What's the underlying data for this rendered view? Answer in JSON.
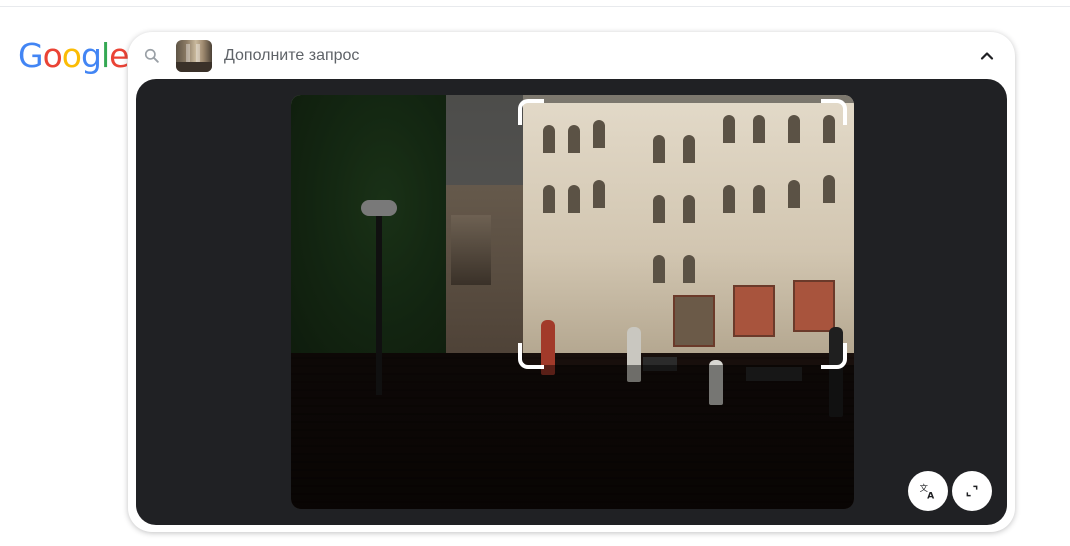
{
  "logo": {
    "letters": [
      {
        "char": "G",
        "color": "#4285F4"
      },
      {
        "char": "o",
        "color": "#EA4335"
      },
      {
        "char": "o",
        "color": "#FBBC05"
      },
      {
        "char": "g",
        "color": "#4285F4"
      },
      {
        "char": "l",
        "color": "#34A853"
      },
      {
        "char": "e",
        "color": "#EA4335"
      }
    ]
  },
  "search": {
    "placeholder": "Дополните запрос",
    "value": "",
    "icon": "search-icon",
    "collapse_icon": "chevron-up-icon"
  },
  "viewer": {
    "background": "#202124",
    "tools": [
      {
        "name": "translate-button",
        "icon": "translate-icon"
      },
      {
        "name": "fullscreen-button",
        "icon": "expand-icon"
      }
    ]
  }
}
